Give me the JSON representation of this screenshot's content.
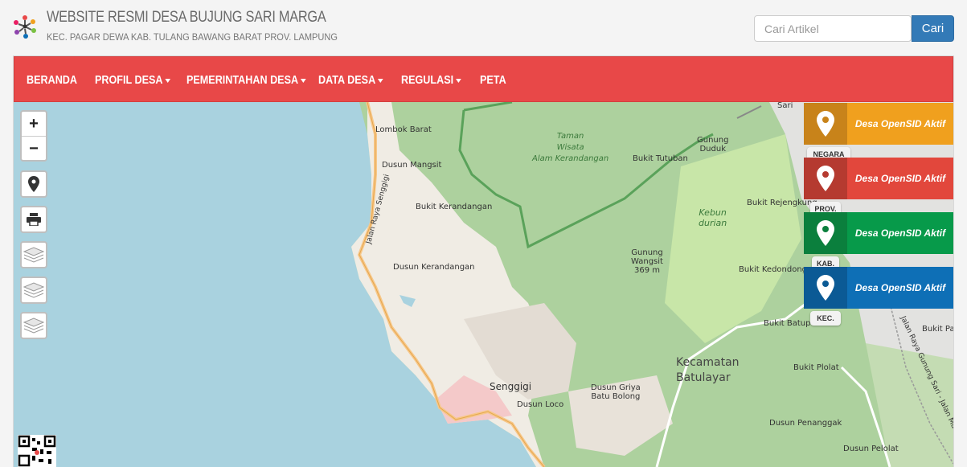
{
  "header": {
    "title": "WEBSITE RESMI DESA BUJUNG SARI MARGA",
    "subtitle": "KEC. PAGAR DEWA KAB. TULANG BAWANG BARAT PROV. LAMPUNG",
    "search_placeholder": "Cari Artikel",
    "search_button": "Cari"
  },
  "nav": {
    "items": [
      {
        "label": "BERANDA",
        "dropdown": false
      },
      {
        "label": "PROFIL DESA",
        "dropdown": true
      },
      {
        "label": "PEMERINTAHAN DESA",
        "dropdown": true
      },
      {
        "label": "DATA DESA",
        "dropdown": true
      },
      {
        "label": "REGULASI",
        "dropdown": true
      },
      {
        "label": "PETA",
        "dropdown": false
      }
    ],
    "color": "#e84848"
  },
  "map": {
    "zoom_in": "+",
    "zoom_out": "−",
    "labels": {
      "lombok_barat": "Lombok Barat",
      "dusun_mangsit": "Dusun Mangsit",
      "jalan_raya_senggigi": "Jalan Raya Senggigi",
      "bukit_kerandangan": "Bukit Kerandangan",
      "dusun_kerandangan": "Dusun Kerandangan",
      "taman_wisata": "Taman\nWisata\nAlam Kerandangan",
      "bukit_tutuban": "Bukit Tutuban",
      "gunung_duduk": "Gunung\nDuduk",
      "kebun_durian": "Kebun\ndurian",
      "gunung_wangsit": "Gunung\nWangsit\n369 m",
      "bukit_rejengkung": "Bukit Rejengkung",
      "bukit_kedondong": "Bukit Kedondong",
      "bukit_batupe": "Bukit Batupe",
      "bukit_pat": "Bukit Pat",
      "bukit_plolat": "Bukit Plolat",
      "kecamatan": "Kecamatan\nBatulayar",
      "senggigi": "Senggigi",
      "dusun_griya": "Dusun Griya\nBatu Bolong",
      "dusun_loco": "Dusun Loco",
      "dusun_penanggak": "Dusun Penanggak",
      "dusun_pelolat": "Dusun Pelolat",
      "sari": "Sari",
      "jalan_raya_gunung_sari": "Jalan Raya Gunung Sari - Jalan Mata"
    }
  },
  "regions": [
    {
      "tag": "NEGARA",
      "text": "Desa OpenSID Aktif",
      "color": "#f0a01e",
      "icon_color": "#c8831a"
    },
    {
      "tag": "PROV.",
      "text": "Desa OpenSID Aktif",
      "color": "#e2473c",
      "icon_color": "#b53a30"
    },
    {
      "tag": "KAB.",
      "text": "Desa OpenSID Aktif",
      "color": "#079a4a",
      "icon_color": "#0b7f3d"
    },
    {
      "tag": "KEC.",
      "text": "Desa OpenSID Aktif",
      "color": "#0e6fb6",
      "icon_color": "#0b5a95"
    }
  ]
}
